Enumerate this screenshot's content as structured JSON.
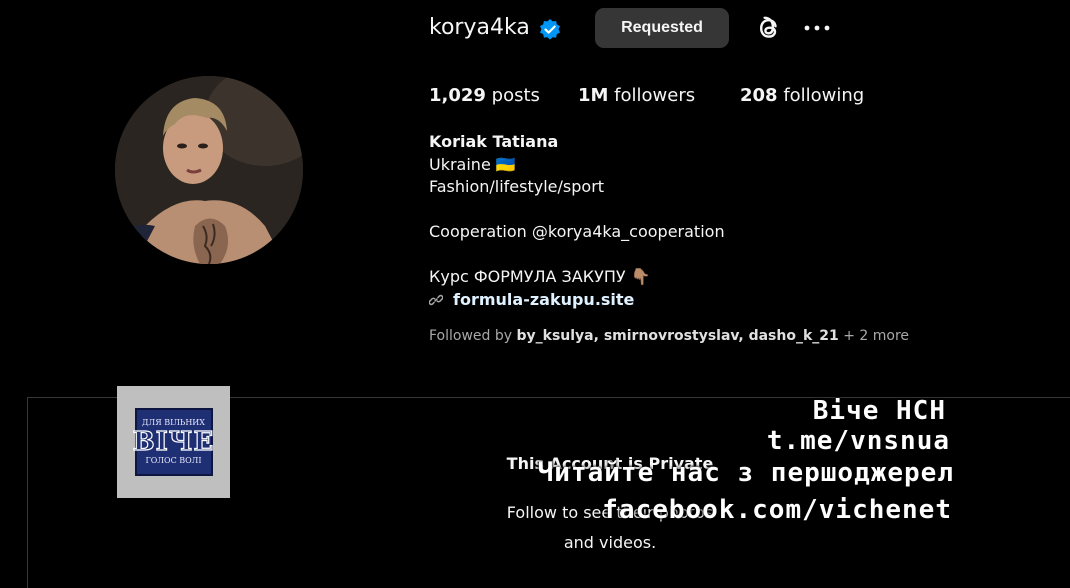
{
  "header": {
    "username": "korya4ka",
    "action_button": "Requested",
    "icons": [
      "verified-badge-icon",
      "threads-icon",
      "more-options-icon"
    ],
    "colors": {
      "verified": "#0095f6",
      "button_bg": "#363636"
    }
  },
  "stats": {
    "posts_count": "1,029",
    "posts_label": "posts",
    "followers_count": "1M",
    "followers_label": "followers",
    "following_count": "208",
    "following_label": "following"
  },
  "bio": {
    "full_name": "Koriak Tatiana",
    "line1": "Ukraine 🇺🇦",
    "line2": "Fashion/lifestyle/sport",
    "line3": "Cooperation @korya4ka_cooperation",
    "line4": "Курс ФОРМУЛА ЗАКУПУ 👇🏽",
    "link": "formula-zakupu.site"
  },
  "followed_by": {
    "prefix": "Followed by",
    "users": "by_ksulya, smirnovrostyslav, dasho_k_21",
    "suffix": "+ 2 more"
  },
  "private": {
    "title": "This Account is Private",
    "subtitle": "Follow to see their photos and videos."
  },
  "watermark": {
    "logo_top": "ДЛЯ ВІЛЬНИХ",
    "logo_mid": "ВІЧЕ",
    "logo_bottom": "ГОЛОС ВОЛІ",
    "line1": "Віче НСН",
    "line2": "t.me/vnsnua",
    "line3": "Читайте нас з першоджерел",
    "line4": "facebook.com/vichenet"
  }
}
